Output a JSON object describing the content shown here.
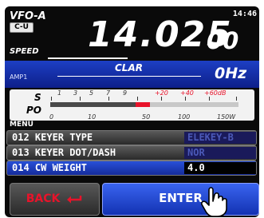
{
  "header": {
    "vfo_label": "VFO-A",
    "mode_badge": "C-U",
    "clock": "14:46",
    "speed_label": "SPEED",
    "freq_main": "14.025",
    "freq_sub": "00"
  },
  "clar_band": {
    "amp_label": "AMP1",
    "clar_label": "CLAR",
    "offset": "0Hz"
  },
  "meter": {
    "s_label": "S",
    "po_label": "PO",
    "s_scale": [
      "1",
      "3",
      "5",
      "7",
      "9",
      "+20",
      "+40",
      "+60dB"
    ],
    "po_scale": [
      "0",
      "10",
      "50",
      "100",
      "150W"
    ]
  },
  "menu": {
    "title": "MENU",
    "items": [
      {
        "label": "012 KEYER TYPE",
        "value": "ELEKEY-B"
      },
      {
        "label": "013 KEYER DOT/DASH",
        "value": "NOR"
      },
      {
        "label": "014 CW WEIGHT",
        "value": "4.0"
      }
    ]
  },
  "buttons": {
    "back": "BACK",
    "enter": "ENTER"
  },
  "colors": {
    "accent_blue": "#1d3fc4",
    "back_red": "#e8132a"
  },
  "icons": [
    "back-arrow-icon",
    "pointing-hand-icon"
  ]
}
